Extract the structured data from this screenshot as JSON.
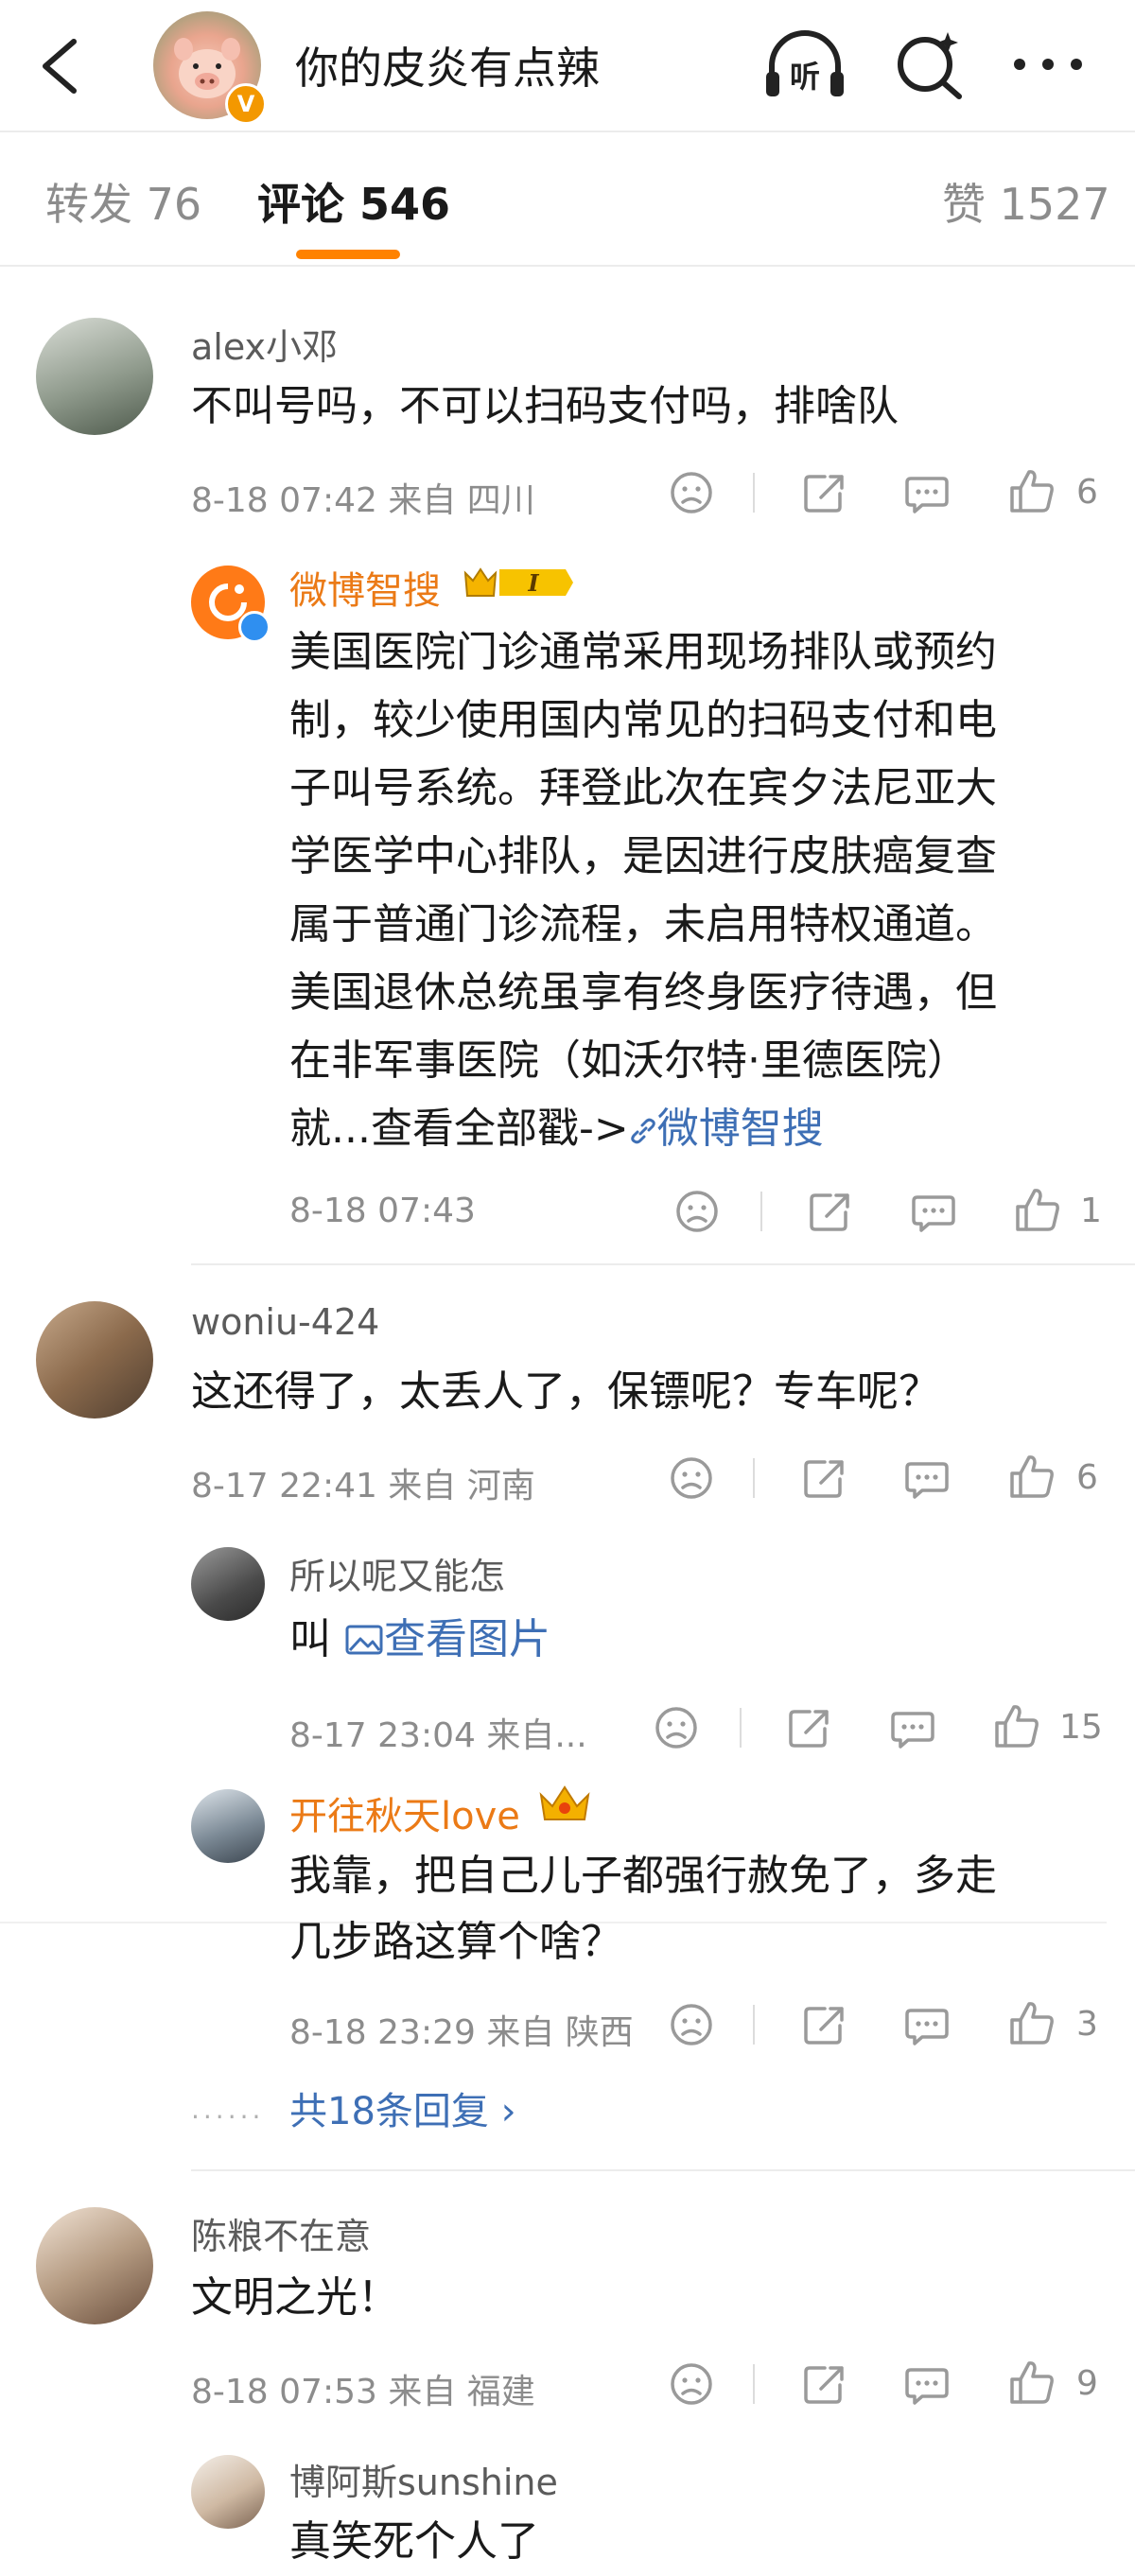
{
  "header": {
    "title": "你的皮炎有点辣"
  },
  "tabs": {
    "repost": "转发 76",
    "comment": "评论 546",
    "like": "赞 1527"
  },
  "c1": {
    "user": "alex小邓",
    "text": "不叫号吗，不可以扫码支付吗，排啥队",
    "meta": "8-18 07:42  来自 四川",
    "likes": "6",
    "reply": {
      "user": "微博智搜",
      "badge": "I",
      "lines": [
        "美国医院门诊通常采用现场排队或预约",
        "制，较少使用国内常见的扫码支付和电",
        "子叫号系统。拜登此次在宾夕法尼亚大",
        "学医学中心排队，是因进行皮肤癌复查",
        "属于普通门诊流程，未启用特权通道。",
        "美国退休总统虽享有终身医疗待遇，但",
        "在非军事医院（如沃尔特·里德医院）"
      ],
      "last_prefix": "就...查看全部戳->",
      "last_link": "微博智搜",
      "meta": "8-18 07:43",
      "likes": "1"
    }
  },
  "c2": {
    "user": "woniu-424",
    "text": "这还得了，太丢人了，保镖呢？专车呢？",
    "meta": "8-17 22:41  来自 河南",
    "likes": "6",
    "r1": {
      "user": "所以呢又能怎",
      "prefix": "叫",
      "link": "查看图片",
      "meta": "8-17 23:04  来自...",
      "likes": "15"
    },
    "r2": {
      "user": "开往秋天love",
      "line1": "我靠，把自己儿子都强行赦免了，多走",
      "line2": "几步路这算个啥？",
      "meta": "8-18 23:29  来自 陕西",
      "likes": "3"
    },
    "more": "共18条回复"
  },
  "c3": {
    "user": "陈粮不在意",
    "text": "文明之光！",
    "meta": "8-18 07:53  来自 福建",
    "likes": "9",
    "r1": {
      "user": "博阿斯sunshine",
      "text": "真笑死个人了"
    }
  }
}
